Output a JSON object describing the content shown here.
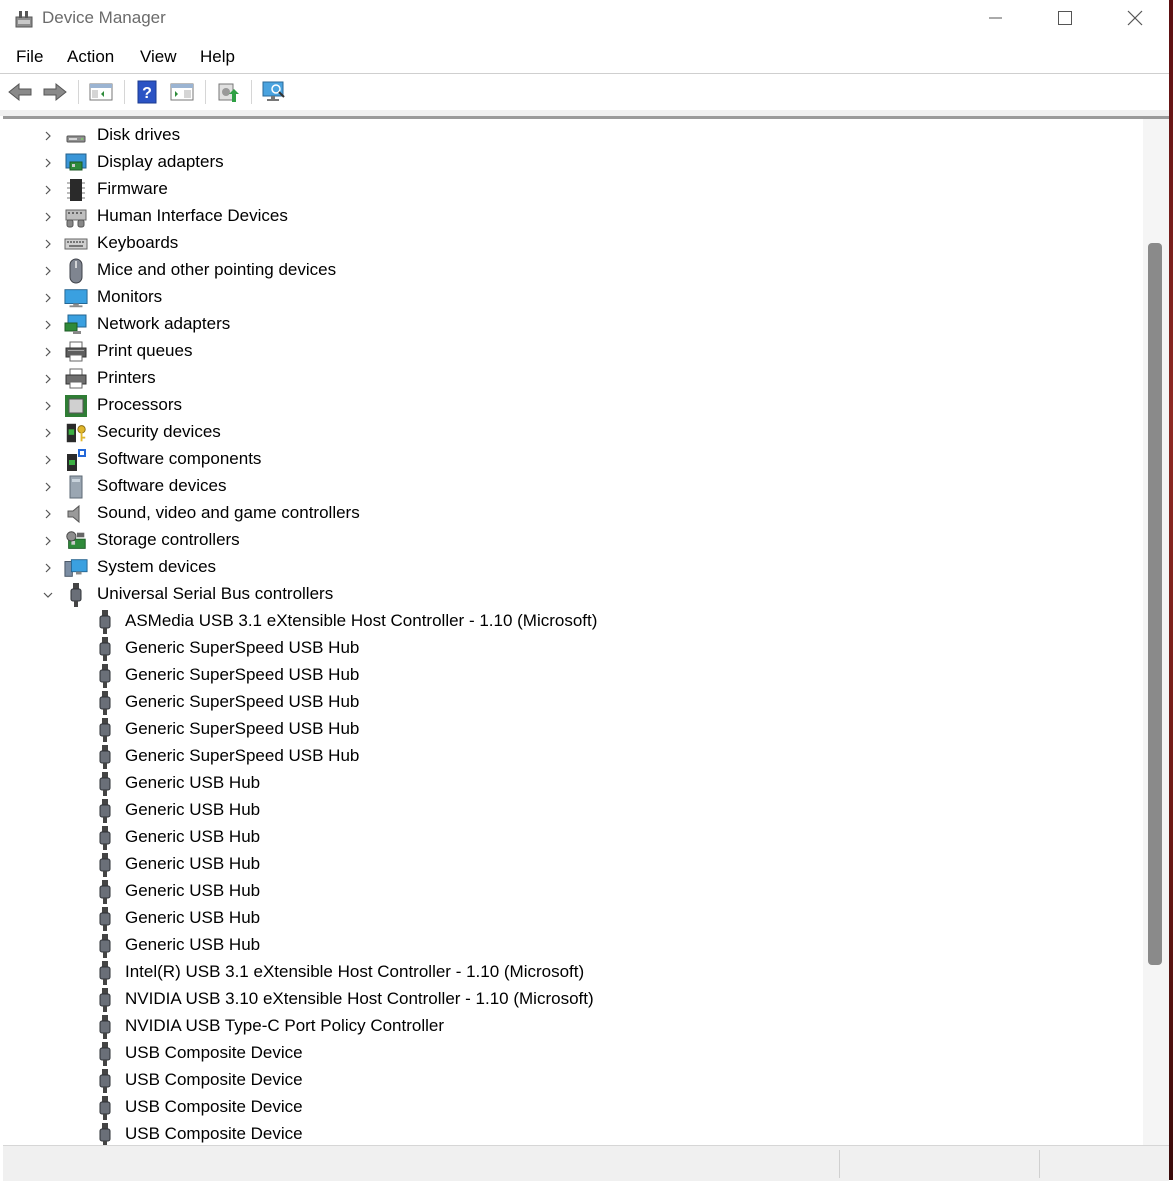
{
  "window": {
    "title": "Device Manager"
  },
  "menu": [
    {
      "label": "File"
    },
    {
      "label": "Action"
    },
    {
      "label": "View"
    },
    {
      "label": "Help"
    }
  ],
  "toolbar": {
    "buttons": [
      "back-icon",
      "forward-icon",
      "show-hide-console-tree-icon",
      "help-icon",
      "properties-icon",
      "update-driver-icon",
      "scan-hardware-icon"
    ]
  },
  "tree": {
    "categories": [
      {
        "label": "Disk drives",
        "icon": "disk-drive-icon",
        "expanded": false
      },
      {
        "label": "Display adapters",
        "icon": "display-adapter-icon",
        "expanded": false
      },
      {
        "label": "Firmware",
        "icon": "firmware-icon",
        "expanded": false
      },
      {
        "label": "Human Interface Devices",
        "icon": "hid-icon",
        "expanded": false
      },
      {
        "label": "Keyboards",
        "icon": "keyboard-icon",
        "expanded": false
      },
      {
        "label": "Mice and other pointing devices",
        "icon": "mouse-icon",
        "expanded": false
      },
      {
        "label": "Monitors",
        "icon": "monitor-icon",
        "expanded": false
      },
      {
        "label": "Network adapters",
        "icon": "network-adapter-icon",
        "expanded": false
      },
      {
        "label": "Print queues",
        "icon": "print-queue-icon",
        "expanded": false
      },
      {
        "label": "Printers",
        "icon": "printer-icon",
        "expanded": false
      },
      {
        "label": "Processors",
        "icon": "processor-icon",
        "expanded": false
      },
      {
        "label": "Security devices",
        "icon": "security-device-icon",
        "expanded": false
      },
      {
        "label": "Software components",
        "icon": "software-component-icon",
        "expanded": false
      },
      {
        "label": "Software devices",
        "icon": "software-device-icon",
        "expanded": false
      },
      {
        "label": "Sound, video and game controllers",
        "icon": "speaker-icon",
        "expanded": false
      },
      {
        "label": "Storage controllers",
        "icon": "storage-controller-icon",
        "expanded": false
      },
      {
        "label": "System devices",
        "icon": "system-device-icon",
        "expanded": false
      },
      {
        "label": "Universal Serial Bus controllers",
        "icon": "usb-icon",
        "expanded": true
      }
    ],
    "usb_children": [
      "ASMedia USB 3.1 eXtensible Host Controller - 1.10 (Microsoft)",
      "Generic SuperSpeed USB Hub",
      "Generic SuperSpeed USB Hub",
      "Generic SuperSpeed USB Hub",
      "Generic SuperSpeed USB Hub",
      "Generic SuperSpeed USB Hub",
      "Generic USB Hub",
      "Generic USB Hub",
      "Generic USB Hub",
      "Generic USB Hub",
      "Generic USB Hub",
      "Generic USB Hub",
      "Generic USB Hub",
      "Intel(R) USB 3.1 eXtensible Host Controller - 1.10 (Microsoft)",
      "NVIDIA USB 3.10 eXtensible Host Controller - 1.10 (Microsoft)",
      "NVIDIA USB Type-C Port Policy Controller",
      "USB Composite Device",
      "USB Composite Device",
      "USB Composite Device",
      "USB Composite Device"
    ]
  }
}
